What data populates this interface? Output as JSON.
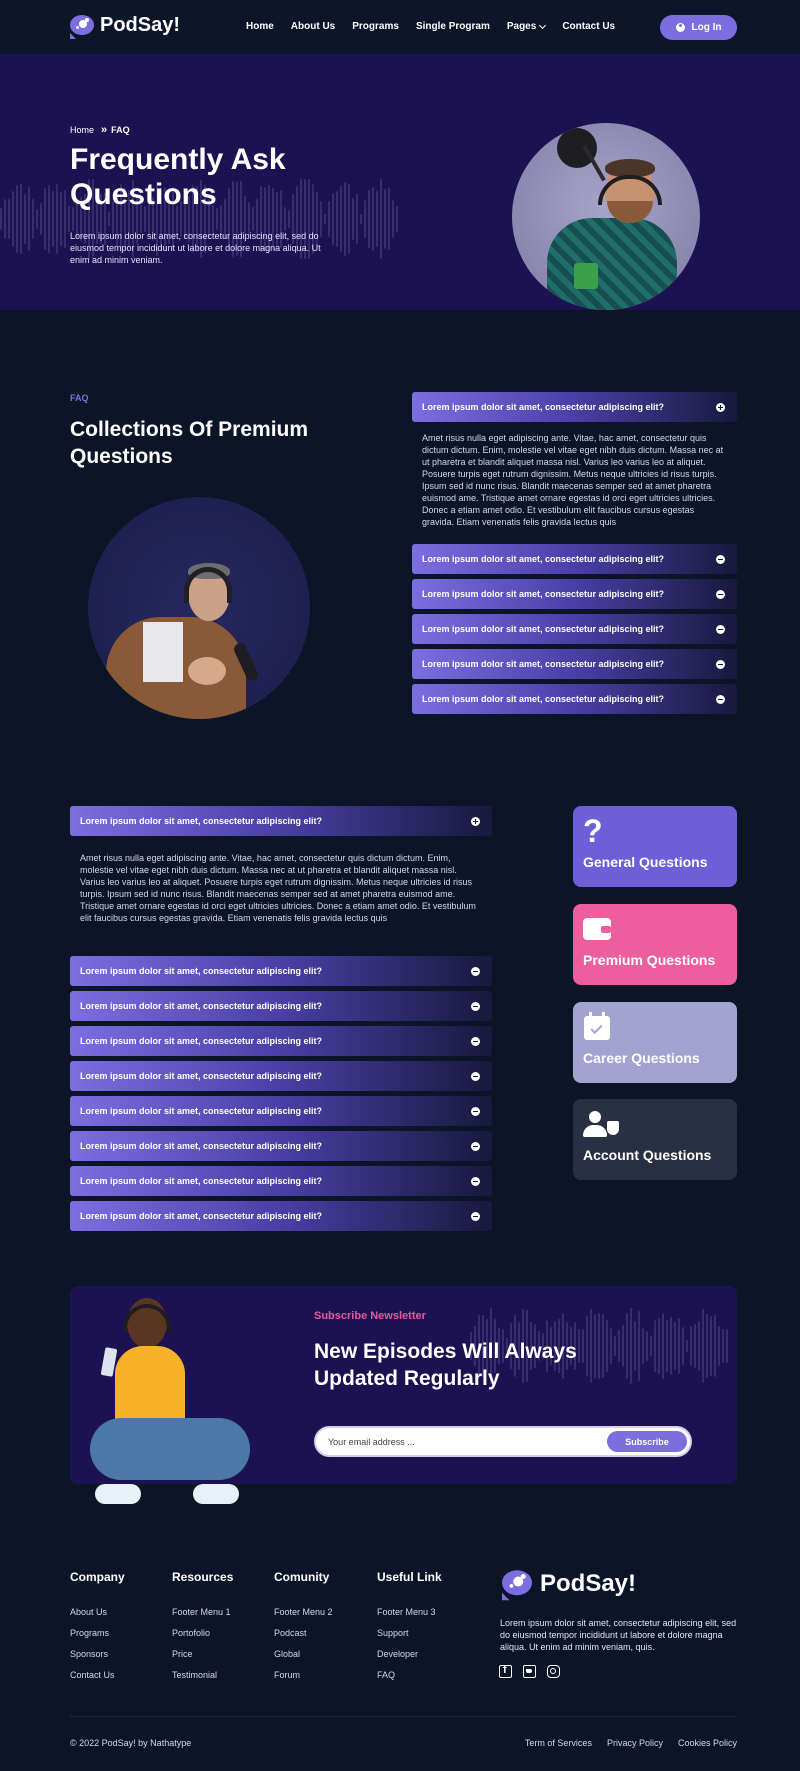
{
  "brand": {
    "name": "PodSay!"
  },
  "nav": {
    "links": [
      "Home",
      "About Us",
      "Programs",
      "Single Program",
      "Pages",
      "Contact Us"
    ],
    "login": "Log In"
  },
  "hero": {
    "breadcrumb": {
      "home": "Home",
      "current": "FAQ"
    },
    "title": "Frequently Ask Questions",
    "description": "Lorem ipsum dolor sit amet, consectetur adipiscing elit, sed do eiusmod tempor incididunt ut labore et dolore magna aliqua. Ut enim ad minim veniam."
  },
  "faq1": {
    "tag": "FAQ",
    "title": "Collections Of Premium Questions",
    "open_question": "Lorem ipsum dolor sit amet, consectetur adipiscing elit?",
    "open_answer": "Amet risus nulla eget adipiscing ante. Vitae, hac amet, consectetur quis dictum dictum. Enim, molestie vel vitae eget nibh duis dictum. Massa nec at ut pharetra et blandit aliquet massa nisl. Varius leo varius leo at aliquet. Posuere turpis eget rutrum dignissim. Metus neque ultricies id risus turpis. Ipsum sed id nunc risus. Blandit maecenas semper sed at amet pharetra euismod ame. Tristique amet ornare egestas id orci eget ultricies ultricies. Donec a etiam amet odio. Et vestibulum elit faucibus cursus egestas gravida. Etiam venenatis felis gravida lectus quis",
    "questions": [
      "Lorem ipsum dolor sit amet, consectetur adipiscing elit?",
      "Lorem ipsum dolor sit amet, consectetur adipiscing elit?",
      "Lorem ipsum dolor sit amet, consectetur adipiscing elit?",
      "Lorem ipsum dolor sit amet, consectetur adipiscing elit?",
      "Lorem ipsum dolor sit amet, consectetur adipiscing elit?"
    ]
  },
  "faq2": {
    "open_question": "Lorem ipsum dolor sit amet, consectetur adipiscing elit?",
    "open_answer": "Amet risus nulla eget adipiscing ante. Vitae, hac amet, consectetur quis dictum dictum. Enim, molestie vel vitae eget nibh duis dictum. Massa nec at ut pharetra et blandit aliquet massa nisl. Varius leo varius leo at aliquet. Posuere turpis eget rutrum dignissim. Metus neque ultricies id risus turpis. Ipsum sed id nunc risus. Blandit maecenas semper sed at amet pharetra euismod ame. Tristique amet ornare egestas id orci eget ultricies ultricies. Donec a etiam amet odio. Et vestibulum elit faucibus cursus egestas gravida. Etiam venenatis felis gravida lectus quis",
    "questions": [
      "Lorem ipsum dolor sit amet, consectetur adipiscing elit?",
      "Lorem ipsum dolor sit amet, consectetur adipiscing elit?",
      "Lorem ipsum dolor sit amet, consectetur adipiscing elit?",
      "Lorem ipsum dolor sit amet, consectetur adipiscing elit?",
      "Lorem ipsum dolor sit amet, consectetur adipiscing elit?",
      "Lorem ipsum dolor sit amet, consectetur adipiscing elit?",
      "Lorem ipsum dolor sit amet, consectetur adipiscing elit?",
      "Lorem ipsum dolor sit amet, consectetur adipiscing elit?"
    ]
  },
  "categories": [
    {
      "label": "General Questions",
      "icon": "question-icon",
      "color": "#6e5fd8"
    },
    {
      "label": "Premium Questions",
      "icon": "wallet-icon",
      "color": "#ec5e9e"
    },
    {
      "label": "Career Questions",
      "icon": "calendar-check-icon",
      "color": "#a3a3d0"
    },
    {
      "label": "Account Questions",
      "icon": "user-shield-icon",
      "color": "#2a3044"
    }
  ],
  "newsletter": {
    "tag": "Subscribe Newsletter",
    "title": "New Episodes Will Always Updated Regularly",
    "placeholder": "Your email address ...",
    "button": "Subscribe"
  },
  "footer": {
    "columns": [
      {
        "title": "Company",
        "items": [
          "About Us",
          "Programs",
          "Sponsors",
          "Contact Us"
        ]
      },
      {
        "title": "Resources",
        "items": [
          "Footer Menu 1",
          "Portofolio",
          "Price",
          "Testimonial"
        ]
      },
      {
        "title": "Comunity",
        "items": [
          "Footer Menu 2",
          "Podcast",
          "Global",
          "Forum"
        ]
      },
      {
        "title": "Useful Link",
        "items": [
          "Footer Menu 3",
          "Support",
          "Developer",
          "FAQ"
        ]
      }
    ],
    "description": "Lorem ipsum dolor sit amet, consectetur adipiscing elit, sed do eiusmod tempor incididunt ut labore et dolore magna aliqua. Ut enim ad minim veniam, quis.",
    "copyright": "© 2022 PodSay! by Nathatype",
    "legal": [
      "Term of Services",
      "Privacy Policy",
      "Cookies Policy"
    ]
  },
  "colors": {
    "background": "#0c1428",
    "hero": "#1c1251",
    "accent": "#7d6ee0",
    "pink": "#e75a9c"
  }
}
